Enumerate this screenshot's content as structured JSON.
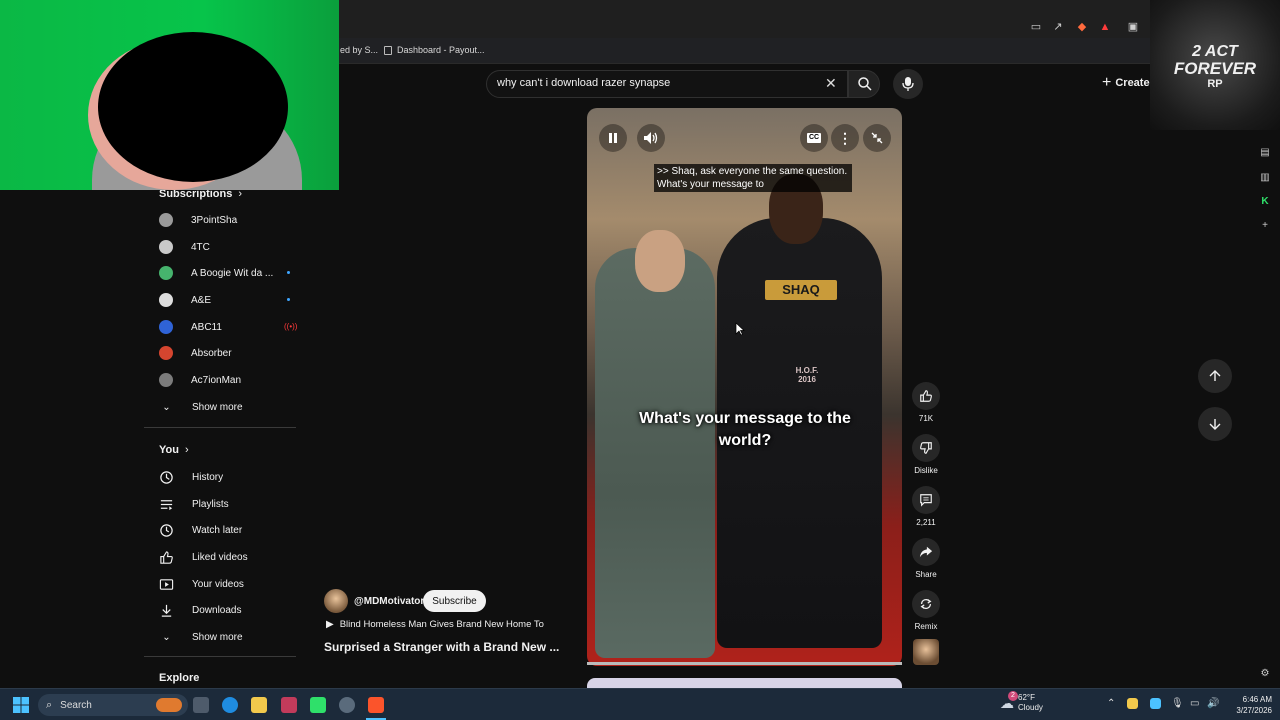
{
  "browser": {
    "bookmarks": [
      {
        "label": "ed by S..."
      },
      {
        "label": "Dashboard - Payout..."
      }
    ]
  },
  "search": {
    "value": "why can't i download razer synapse"
  },
  "header": {
    "create_label": "Create"
  },
  "logo_overlay": {
    "line1": "2 ACT",
    "line2": "FOREVER",
    "line3": "RP"
  },
  "sidebar": {
    "subscriptions_title": "Subscriptions",
    "subscriptions": [
      {
        "name": "3PointSha",
        "color": "#9a9a9a",
        "badge": ""
      },
      {
        "name": "4TC",
        "color": "#c9c9c9",
        "badge": ""
      },
      {
        "name": "A Boogie Wit da ...",
        "color": "#46b36d",
        "badge": "dot"
      },
      {
        "name": "A&E",
        "color": "#dedede",
        "badge": "dot"
      },
      {
        "name": "ABC11",
        "color": "#2f63d6",
        "badge": "live"
      },
      {
        "name": "Absorber",
        "color": "#d5452f",
        "badge": ""
      },
      {
        "name": "Ac7ionMan",
        "color": "#7c7c7c",
        "badge": ""
      }
    ],
    "show_more_1": "Show more",
    "you_title": "You",
    "you_items": [
      {
        "name": "History",
        "icon": "history-icon"
      },
      {
        "name": "Playlists",
        "icon": "playlists-icon"
      },
      {
        "name": "Watch later",
        "icon": "watch-later-icon"
      },
      {
        "name": "Liked videos",
        "icon": "liked-videos-icon"
      },
      {
        "name": "Your videos",
        "icon": "your-videos-icon"
      },
      {
        "name": "Downloads",
        "icon": "downloads-icon"
      }
    ],
    "show_more_2": "Show more",
    "explore_title": "Explore"
  },
  "video": {
    "caption_line1": ">> Shaq, ask everyone the same question.",
    "caption_line2": "What's your message to",
    "overlay_text": "What's your message to the world?",
    "jersey_text": "SHAQ",
    "hof_text": "H.O.F. 2016"
  },
  "actions": {
    "like_count": "71K",
    "dislike_label": "Dislike",
    "comment_count": "2,211",
    "share_label": "Share",
    "remix_label": "Remix"
  },
  "channel": {
    "name": "@MDMotivator",
    "subscribe_label": "Subscribe",
    "playlist_title": "Blind Homeless Man Gives Brand New Home To",
    "video_title": "Surprised a Stranger with a Brand New ..."
  },
  "taskbar": {
    "search_label": "Search",
    "weather_temp": "62°F",
    "weather_cond": "Cloudy",
    "weather_badge": "2",
    "time": "6:46 AM",
    "date": "3/27/2026"
  }
}
